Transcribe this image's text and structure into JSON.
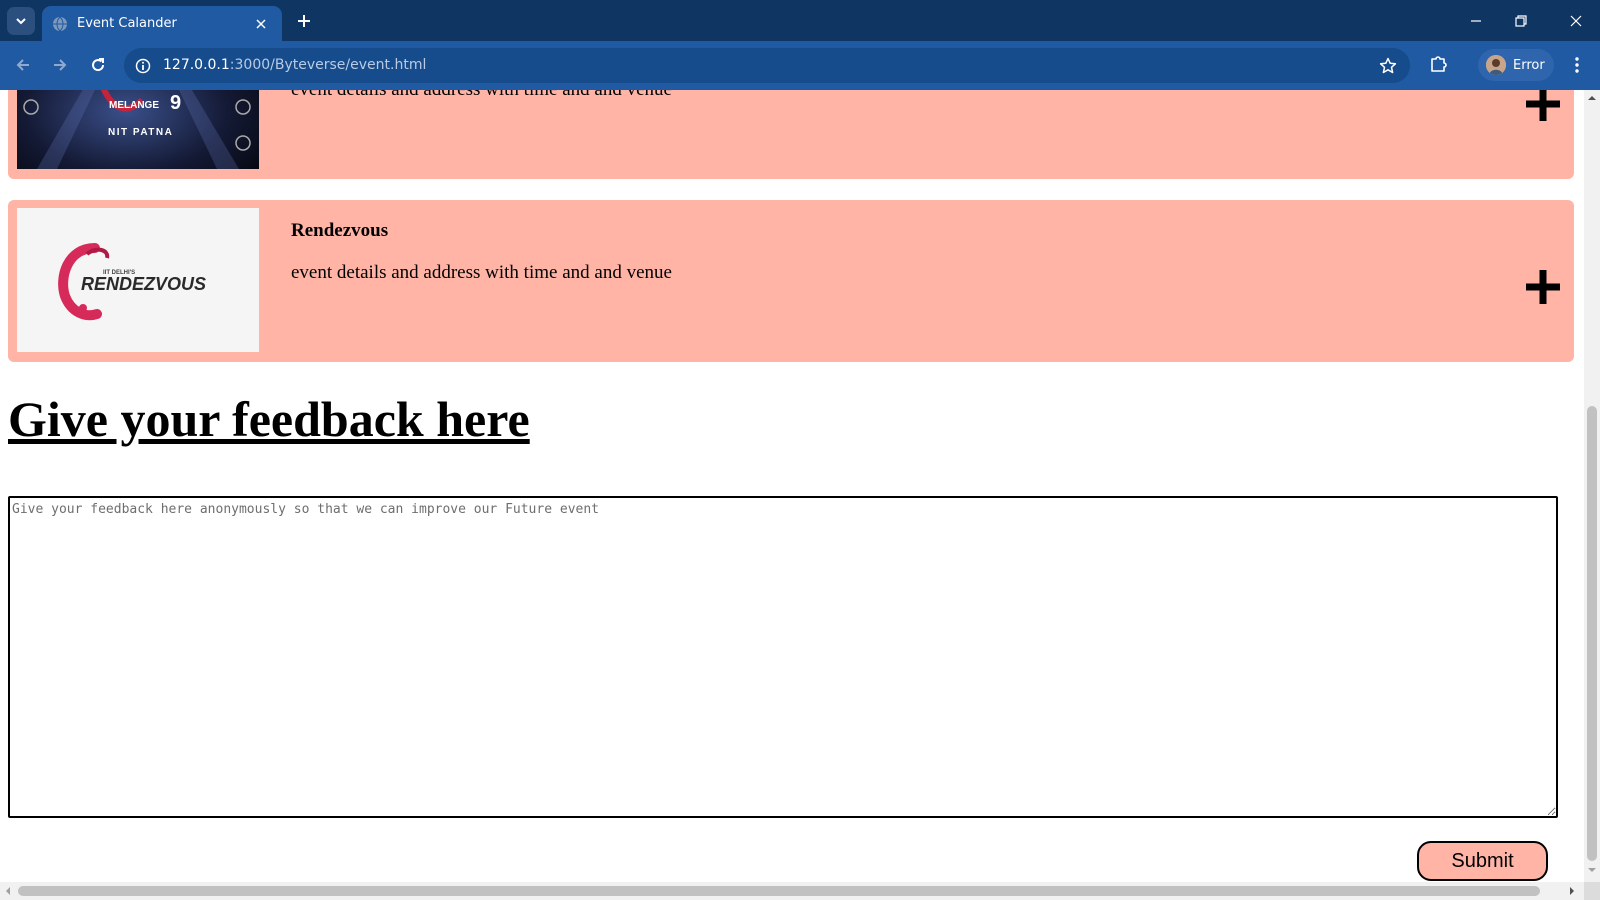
{
  "browser": {
    "tab": {
      "title": "Event Calander",
      "favicon": "globe-icon"
    },
    "url": {
      "host": "127.0.0.1",
      "rest": ":3000/Byteverse/event.html"
    },
    "profile_label": "Error",
    "icons": {
      "tab_search": "chevron-down-icon",
      "tab_close": "close-icon",
      "new_tab": "plus-icon",
      "back": "arrow-left-icon",
      "forward": "arrow-right-icon",
      "reload": "reload-icon",
      "site_info": "info-icon",
      "bookmark": "star-icon",
      "extensions": "puzzle-icon",
      "menu": "kebab-menu-icon"
    },
    "colors": {
      "tabbar": "#0f3563",
      "toolbar": "#1f5aa3"
    }
  },
  "events": [
    {
      "name": "",
      "details": "event details and address with time and and venue",
      "image": {
        "caption_lines": [
          "MELANGE",
          "NIT PATNA"
        ],
        "badge": "9"
      }
    },
    {
      "name": "Rendezvous",
      "details": "event details and address with time and and venue",
      "image": {
        "logo_text": "RENDEZVOUS",
        "small_text": "IIT DELHI'S"
      }
    }
  ],
  "feedback": {
    "heading": "Give your feedback here",
    "placeholder": "Give your feedback here anonymously so that we can improve our Future event",
    "value": "",
    "submit_label": "Submit"
  },
  "colors": {
    "card_background": "#ffb4a6",
    "page_background": "#ffffff"
  }
}
